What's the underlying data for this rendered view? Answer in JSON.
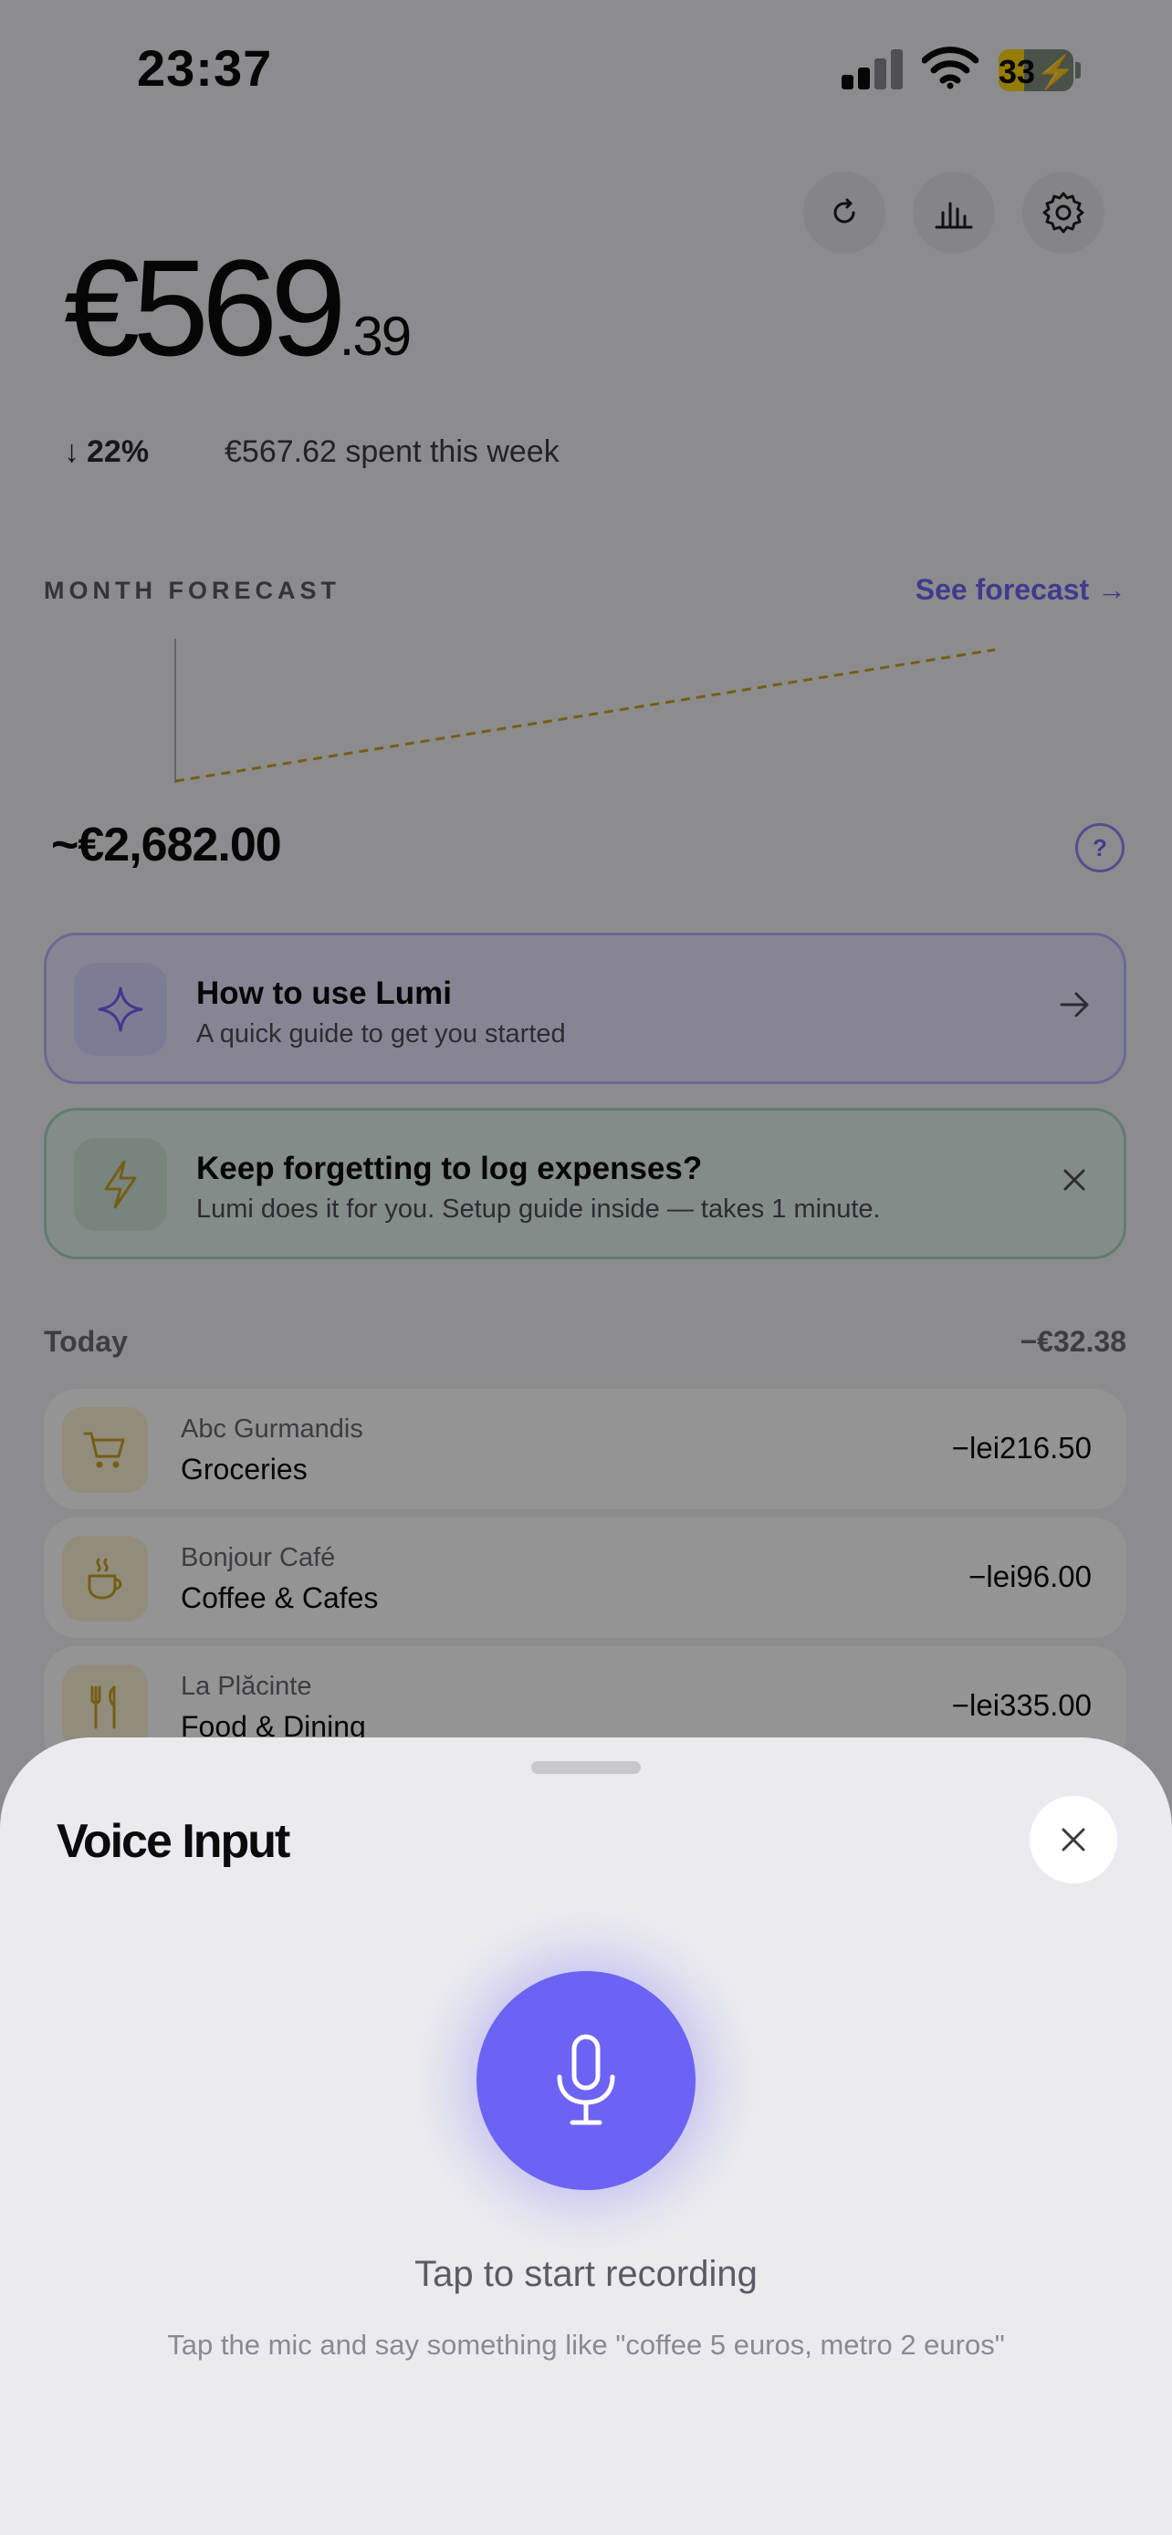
{
  "status": {
    "time": "23:37",
    "battery": "33"
  },
  "balance": {
    "main": "€569",
    "cents": ".39"
  },
  "week": {
    "change": "22%",
    "spent_text": "€567.62 spent this week"
  },
  "forecast": {
    "label": "MONTH FORECAST",
    "link": "See forecast →",
    "value": "~€2,682.00",
    "help": "?"
  },
  "cards": [
    {
      "title": "How to use Lumi",
      "subtitle": "A quick guide to get you started"
    },
    {
      "title": "Keep forgetting to log expenses?",
      "subtitle": "Lumi does it for you. Setup guide inside — takes 1 minute."
    }
  ],
  "today": {
    "label": "Today",
    "total": "−€32.38"
  },
  "transactions": [
    {
      "merchant": "Abc Gurmandis",
      "category": "Groceries",
      "amount": "−lei216.50",
      "icon": "cart-icon"
    },
    {
      "merchant": "Bonjour Café",
      "category": "Coffee & Cafes",
      "amount": "−lei96.00",
      "icon": "coffee-icon"
    },
    {
      "merchant": "La Plăcinte",
      "category": "Food & Dining",
      "amount": "−lei335.00",
      "icon": "fork-knife-icon"
    }
  ],
  "sheet": {
    "title": "Voice Input",
    "prompt": "Tap to start recording",
    "hint": "Tap the mic and say something like \"coffee 5 euros, metro 2 euros\""
  },
  "colors": {
    "accent": "#6c63f5",
    "forecast_line": "#c9a227",
    "icon_gold": "#c9a227"
  }
}
